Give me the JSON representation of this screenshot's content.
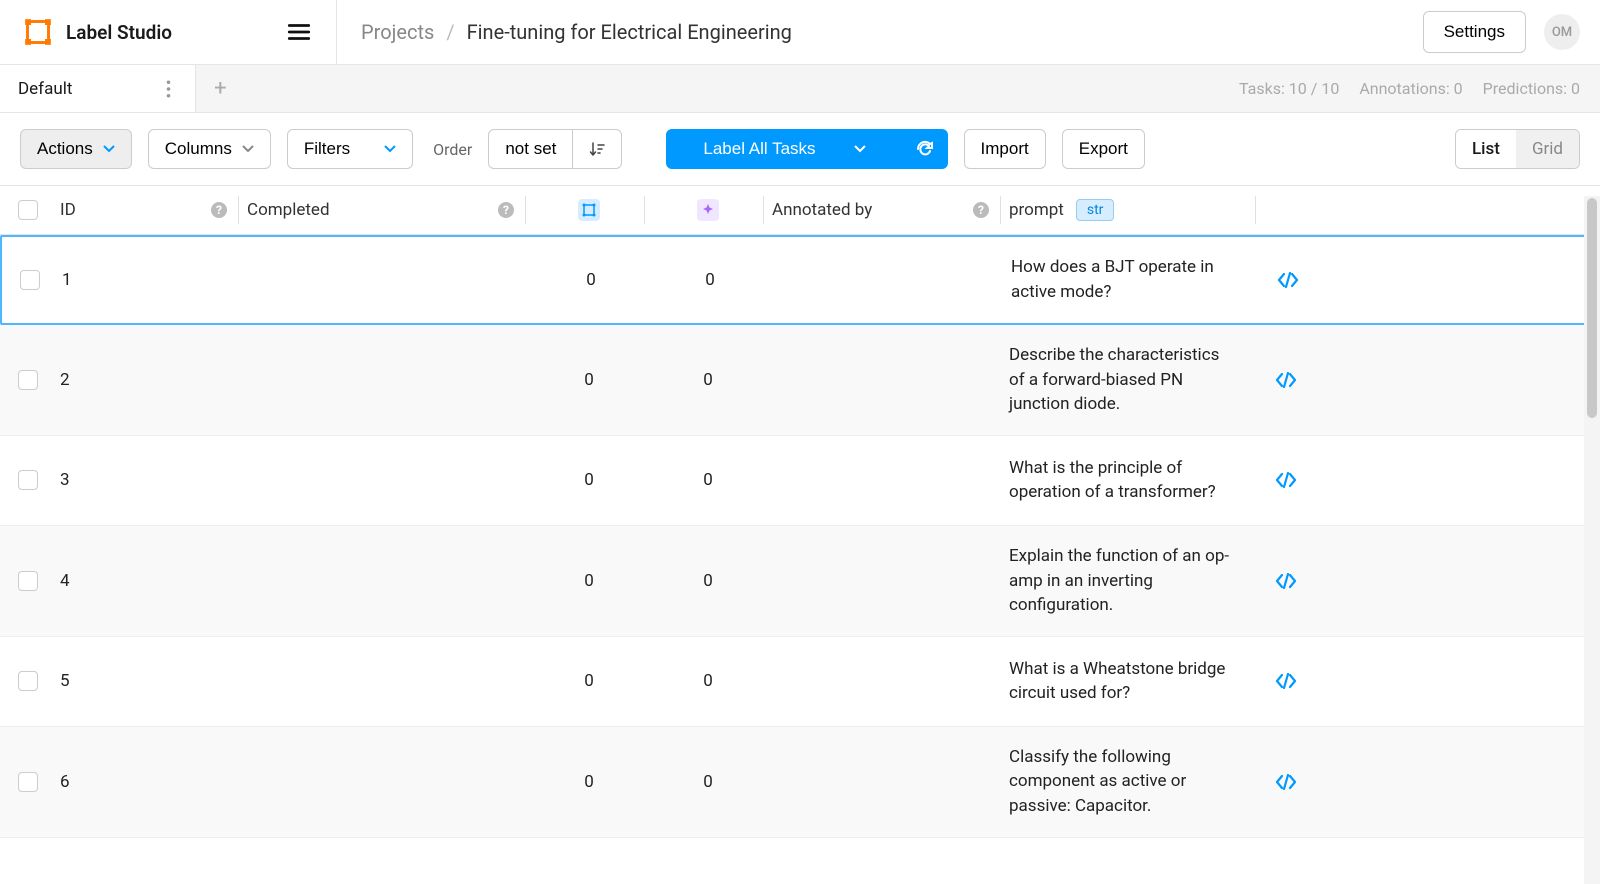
{
  "header": {
    "app_name": "Label Studio",
    "breadcrumb_root": "Projects",
    "breadcrumb_current": "Fine-tuning for Electrical Engineering",
    "settings_label": "Settings",
    "avatar_initials": "OM"
  },
  "subbar": {
    "tab_name": "Default",
    "stats_tasks": "Tasks: 10 / 10",
    "stats_annotations": "Annotations: 0",
    "stats_predictions": "Predictions: 0"
  },
  "toolbar": {
    "actions_label": "Actions",
    "columns_label": "Columns",
    "filters_label": "Filters",
    "order_label": "Order",
    "order_value": "not set",
    "label_all_label": "Label All Tasks",
    "import_label": "Import",
    "export_label": "Export",
    "view_list": "List",
    "view_grid": "Grid"
  },
  "columns": {
    "id": "ID",
    "completed": "Completed",
    "annotated_by": "Annotated by",
    "prompt": "prompt",
    "prompt_type": "str"
  },
  "rows": [
    {
      "id": "1",
      "ann": "0",
      "pred": "0",
      "prompt": "How does a BJT operate in active mode?"
    },
    {
      "id": "2",
      "ann": "0",
      "pred": "0",
      "prompt": "Describe the characteristics of a forward-biased PN junction diode."
    },
    {
      "id": "3",
      "ann": "0",
      "pred": "0",
      "prompt": "What is the principle of operation of a transformer?"
    },
    {
      "id": "4",
      "ann": "0",
      "pred": "0",
      "prompt": "Explain the function of an op-amp in an inverting configuration."
    },
    {
      "id": "5",
      "ann": "0",
      "pred": "0",
      "prompt": "What is a Wheatstone bridge circuit used for?"
    },
    {
      "id": "6",
      "ann": "0",
      "pred": "0",
      "prompt": "Classify the following component as active or passive: Capacitor."
    }
  ]
}
